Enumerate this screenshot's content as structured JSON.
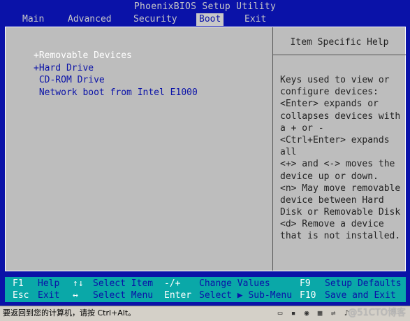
{
  "bios": {
    "title": "PhoenixBIOS Setup Utility",
    "menu": [
      {
        "label": "Main"
      },
      {
        "label": "Advanced"
      },
      {
        "label": "Security"
      },
      {
        "label": "Boot",
        "active": true
      },
      {
        "label": "Exit"
      }
    ],
    "help_title": "Item Specific Help",
    "boot_items": [
      "+Removable Devices",
      "+Hard Drive",
      " CD-ROM Drive",
      " Network boot from Intel E1000"
    ],
    "help_lines": [
      "Keys used to view or",
      "configure devices:",
      "<Enter> expands or",
      "collapses devices with",
      "a + or -",
      "<Ctrl+Enter> expands",
      "all",
      "<+> and <-> moves the",
      "device up or down.",
      "<n> May move removable",
      "device between Hard",
      "Disk or Removable Disk",
      "<d> Remove a device",
      "that is not installed."
    ],
    "footer": {
      "f1_key": "F1",
      "f1_desc": "Help",
      "esc_key": "Esc",
      "esc_desc": "Exit",
      "updown_key": "↑↓",
      "updown_desc": "Select Item",
      "leftright_key": "↔",
      "leftright_desc": "Select Menu",
      "plusminus_key": "-/+",
      "plusminus_desc": "Change Values",
      "enter_key": "Enter",
      "enter_desc": "Select ▶ Sub-Menu",
      "f9_key": "F9",
      "f9_desc": "Setup Defaults",
      "f10_key": "F10",
      "f10_desc": "Save and Exit"
    }
  },
  "statusbar": {
    "text": "要返回到您的计算机，请按 Ctrl+Alt。",
    "watermark": "@51CTO博客"
  },
  "colors": {
    "bios_blue": "#0a12a8",
    "panel_gray": "#bdbdbd",
    "footer_cyan": "#0aa8a8"
  }
}
